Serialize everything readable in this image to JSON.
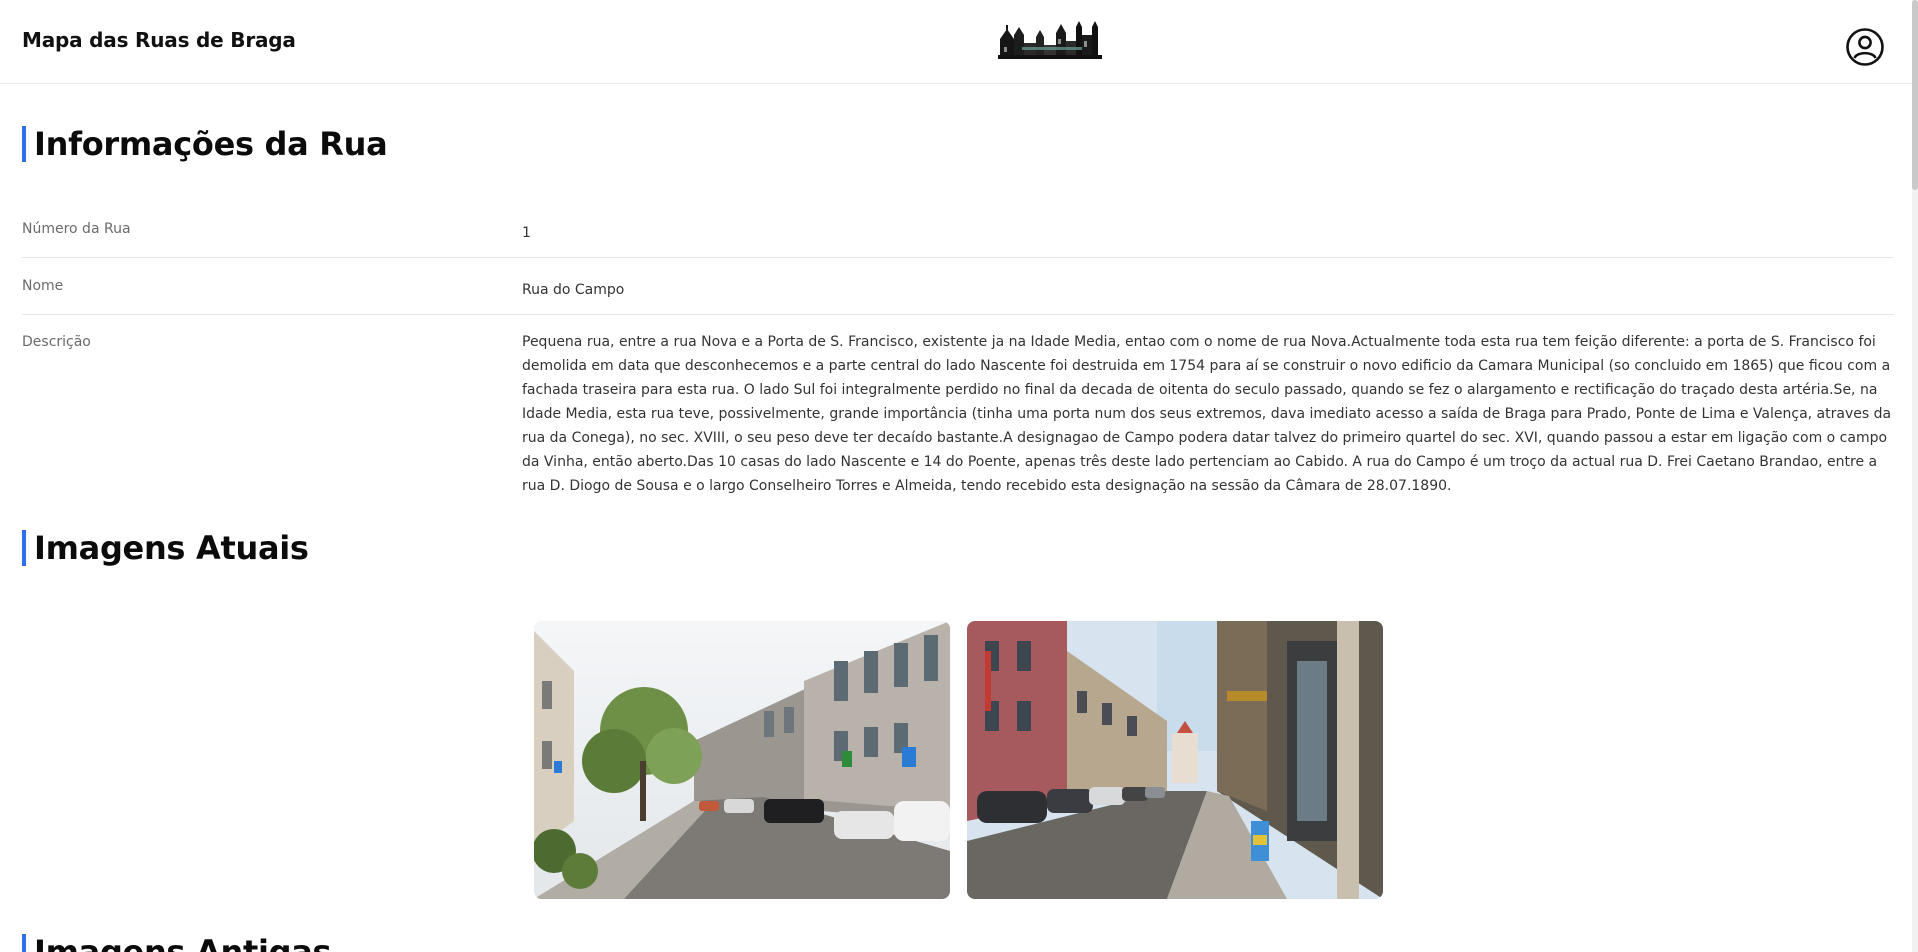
{
  "header": {
    "title": "Mapa das Ruas de Braga",
    "logo_icon": "braga-skyline-logo",
    "user_icon": "user-account-icon"
  },
  "info_section": {
    "title": "Informações da Rua",
    "rows": [
      {
        "label": "Número da Rua",
        "value": "1"
      },
      {
        "label": "Nome",
        "value": "Rua do Campo"
      },
      {
        "label": "Descrição",
        "value": "Pequena rua, entre a rua Nova e a Porta de S. Francisco, existente ja na Idade Media, entao com o nome de rua Nova.Actualmente toda esta rua tem feição diferente: a porta de S. Francisco foi demolida em data que desconhecemos e a parte central do lado Nascente foi destruida em 1754 para aí se construir o novo edificio da Camara Municipal (so concluido em 1865) que ficou com a fachada traseira para esta rua. O lado Sul foi integralmente perdido no final da decada de oitenta do seculo passado, quando se fez o alargamento e rectificação do traçado desta artéria.Se, na Idade Media, esta rua teve, possivelmente, grande importância (tinha uma porta num dos seus extremos, dava imediato acesso a saída de Braga para Prado, Ponte de Lima e Valença, atraves da rua da Conega), no sec. XVIII, o seu peso deve ter decaído bastante.A designagao de Campo podera datar talvez do primeiro quartel do sec. XVI, quando passou a estar em ligação com o campo da Vinha, então aberto.Das 10 casas do lado Nascente e 14 do Poente, apenas três deste lado pertenciam ao Cabido. A rua do Campo é um troço da actual rua D. Frei Caetano Brandao, entre a rua D. Diogo de Sousa e o largo Conselheiro Torres e Almeida, tendo recebido esta designação na sessão da Câmara de 28.07.1890."
      }
    ]
  },
  "current_images": {
    "title": "Imagens Atuais",
    "images": [
      {
        "alt": "street-photo-1"
      },
      {
        "alt": "street-photo-2"
      }
    ]
  },
  "old_images": {
    "title": "Imagens Antigas"
  },
  "colors": {
    "accent": "#2f6fe8",
    "text": "#111111",
    "muted": "#6b6b6b"
  }
}
